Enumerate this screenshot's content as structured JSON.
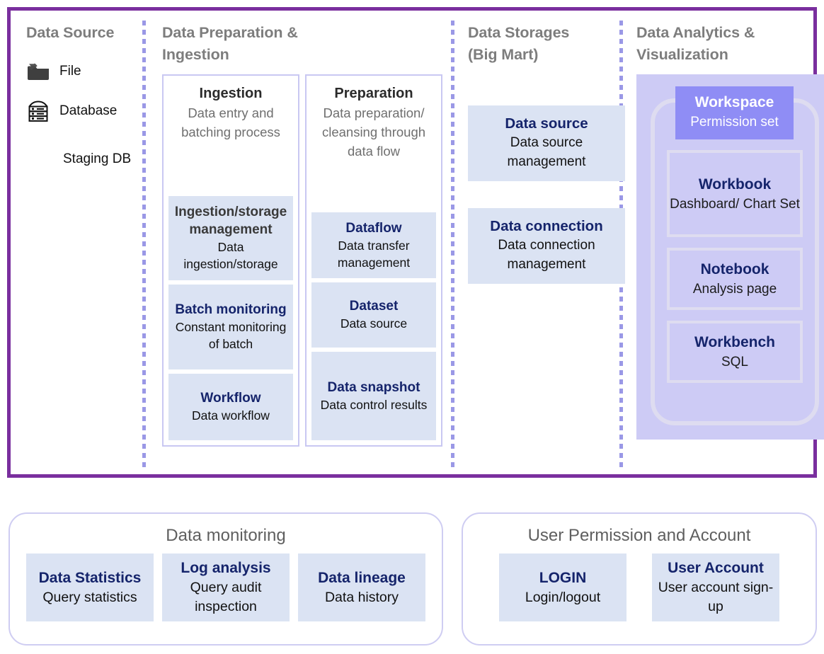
{
  "colors": {
    "panel_border": "#7a2f9e",
    "separator": "#9a98e6",
    "group_border": "#c9c8f2",
    "item_fill": "#dbe3f3",
    "item_title": "#15246b",
    "analytics_bg": "#cdcbf5",
    "workspace_fill": "#8f8df5",
    "inner_border": "#dedcf0",
    "column_title": "#7d7d7d",
    "bottom_panel_border": "#cfcdf2"
  },
  "main_panel": {
    "columns": [
      {
        "id": "data-source",
        "title": "Data Source",
        "items": [
          {
            "icon": "folder-icon",
            "label": "File"
          },
          {
            "icon": "database-icon",
            "label": "Database"
          }
        ],
        "staging_label": "Staging DB"
      },
      {
        "id": "data-preparation-ingestion",
        "title": "Data Preparation &\nIngestion",
        "groups": [
          {
            "id": "ingestion",
            "head_title": "Ingestion",
            "head_sub": "Data entry and batching process",
            "items": [
              {
                "title": "Ingestion/storage management",
                "sub": "Data ingestion/storage",
                "title_style": "dark"
              },
              {
                "title": "Batch monitoring",
                "sub": "Constant monitoring of batch",
                "title_style": "blue"
              },
              {
                "title": "Workflow",
                "sub": "Data workflow",
                "title_style": "blue"
              }
            ]
          },
          {
            "id": "preparation",
            "head_title": "Preparation",
            "head_sub": "Data preparation/ cleansing through data flow",
            "items": [
              {
                "title": "Dataflow",
                "sub": "Data transfer management",
                "title_style": "blue"
              },
              {
                "title": "Dataset",
                "sub": "Data source",
                "title_style": "blue"
              },
              {
                "title": "Data snapshot",
                "sub": "Data control results",
                "title_style": "blue"
              }
            ]
          }
        ]
      },
      {
        "id": "data-storages",
        "title": "Data Storages\n(Big Mart)",
        "boxes": [
          {
            "title": "Data source",
            "sub": "Data source management"
          },
          {
            "title": "Data connection",
            "sub": "Data connection management"
          }
        ]
      },
      {
        "id": "data-analytics-visualization",
        "title": "Data Analytics &\nVisualization",
        "workspace": {
          "title": "Workspace",
          "sub": "Permission set"
        },
        "boxes": [
          {
            "title": "Workbook",
            "sub": "Dashboard/ Chart Set"
          },
          {
            "title": "Notebook",
            "sub": "Analysis page"
          },
          {
            "title": "Workbench",
            "sub": "SQL"
          }
        ]
      }
    ]
  },
  "bottom_panels": [
    {
      "id": "data-monitoring",
      "title": "Data monitoring",
      "boxes": [
        {
          "title": "Data Statistics",
          "sub": "Query statistics"
        },
        {
          "title": "Log analysis",
          "sub": "Query audit inspection"
        },
        {
          "title": "Data lineage",
          "sub": "Data history"
        }
      ]
    },
    {
      "id": "user-permission-and-account",
      "title": "User Permission and Account",
      "boxes": [
        {
          "title": "LOGIN",
          "sub": "Login/logout"
        },
        {
          "title": "User Account",
          "sub": "User account sign-up"
        }
      ]
    }
  ]
}
